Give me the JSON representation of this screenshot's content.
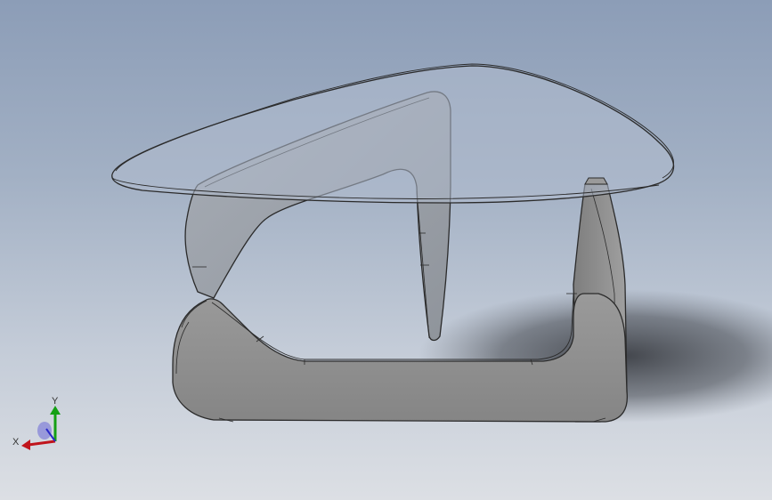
{
  "viewport": {
    "background_top": "#8c9db7",
    "background_bottom": "#dcdfe4",
    "model": {
      "glass_color": "#b0bccd",
      "base_color": "#8e8e8e",
      "edge_color": "#2b2b2b"
    },
    "triad": {
      "x_label": "X",
      "y_label": "Y",
      "x_color": "#c0141c",
      "y_color": "#14a014",
      "z_color": "#2a2ac8"
    }
  }
}
